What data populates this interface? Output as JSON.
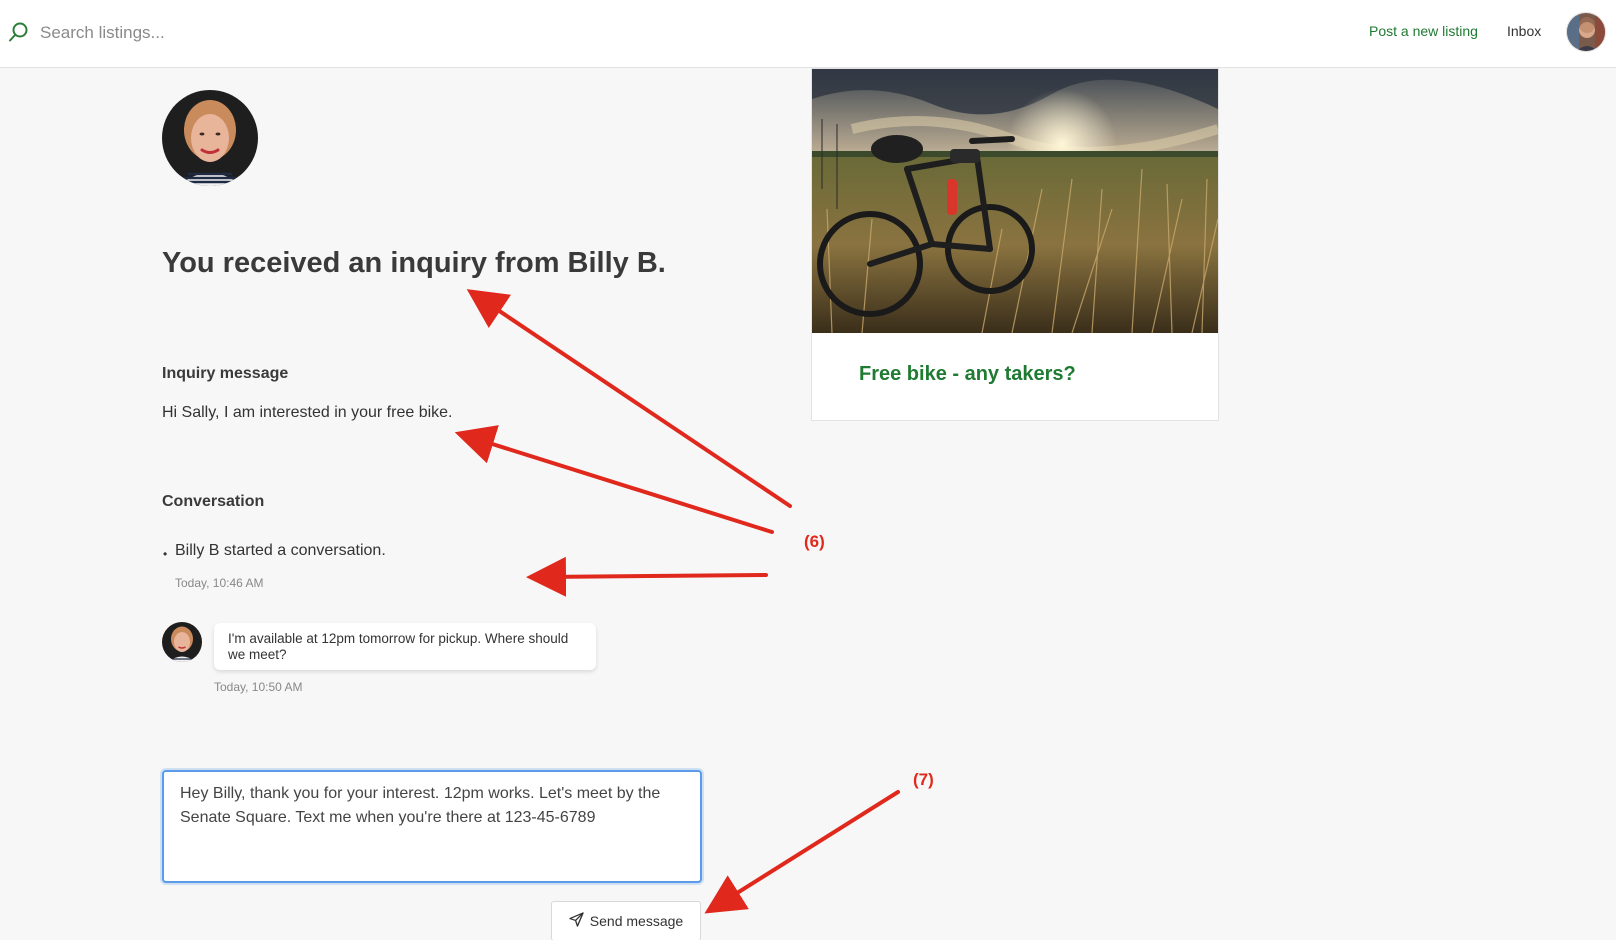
{
  "topbar": {
    "search_placeholder": "Search listings...",
    "post_listing_label": "Post a new listing",
    "inbox_label": "Inbox"
  },
  "inquiry": {
    "title": "You received an inquiry from Billy B.",
    "message_heading": "Inquiry message",
    "message_text": "Hi Sally, I am interested in your free bike."
  },
  "conversation": {
    "heading": "Conversation",
    "bullet": "•",
    "events": [
      {
        "text": "Billy B started a conversation.",
        "time": "Today, 10:46 AM"
      }
    ],
    "messages": [
      {
        "text": "I'm available at 12pm tomorrow for pickup. Where should we meet?",
        "time": "Today, 10:50 AM"
      }
    ]
  },
  "reply": {
    "value": "Hey Billy, thank you for your interest. 12pm works. Let's meet by the Senate Square. Text me when you're there at 123-45-6789",
    "send_label": "Send message"
  },
  "listing": {
    "title": "Free bike - any takers?"
  },
  "annotations": {
    "label_6": "(6)",
    "label_7": "(7)",
    "color": "#e0281c"
  },
  "colors": {
    "accent_green": "#1f7a32",
    "focus_blue": "#5b9bea"
  },
  "icons": {
    "search": "search-icon",
    "send": "send-icon"
  }
}
